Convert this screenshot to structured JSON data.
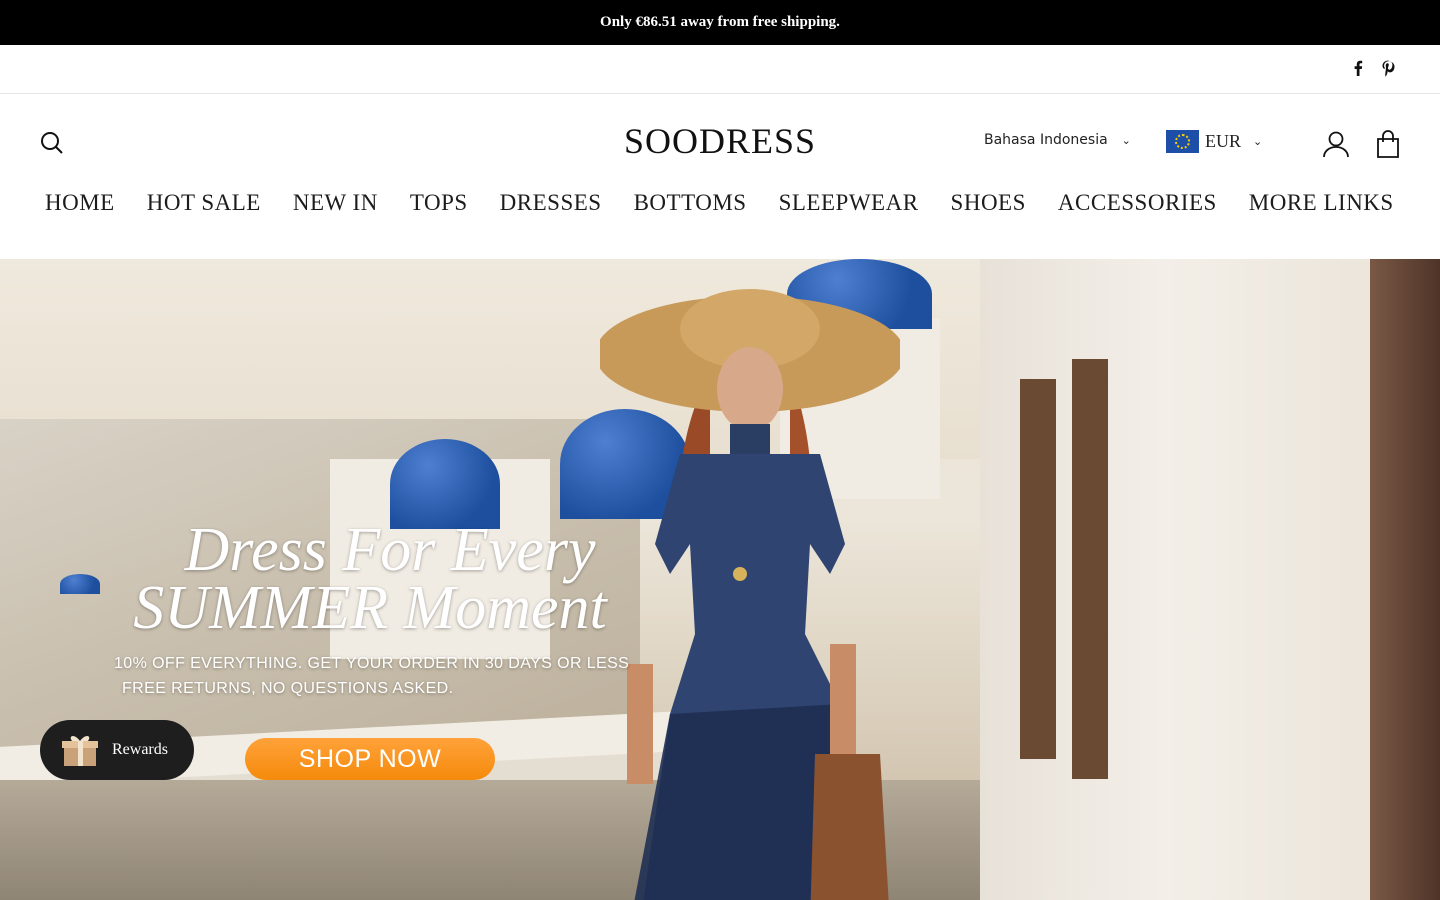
{
  "announcement": {
    "text": "Only €86.51 away from free shipping."
  },
  "social": {
    "icons": [
      "facebook-icon",
      "pinterest-icon"
    ]
  },
  "header": {
    "logo": "SOODRESS",
    "language": "Bahasa Indonesia",
    "currency": "EUR",
    "icons": [
      "search-icon",
      "account-icon",
      "cart-icon"
    ]
  },
  "nav": {
    "items": [
      {
        "label": "HOME"
      },
      {
        "label": "HOT SALE"
      },
      {
        "label": "NEW IN"
      },
      {
        "label": "TOPS"
      },
      {
        "label": "DRESSES"
      },
      {
        "label": "BOTTOMS"
      },
      {
        "label": "SLEEPWEAR"
      },
      {
        "label": "SHOES"
      },
      {
        "label": "ACCESSORIES"
      },
      {
        "label": "MORE LINKS"
      }
    ]
  },
  "hero": {
    "title_line1": "Dress For Every",
    "title_line2": "SUMMER Moment",
    "subtitle_line1": "10% OFF EVERYTHING. GET YOUR ORDER IN 30 DAYS OR LESS",
    "subtitle_line2": "FREE RETURNS, NO QUESTIONS ASKED.",
    "cta": "SHOP NOW"
  },
  "rewards": {
    "label": "Rewards"
  },
  "colors": {
    "cta": "#f58a0b",
    "announcement_bg": "#000000",
    "dome_blue": "#1d4f9e"
  }
}
